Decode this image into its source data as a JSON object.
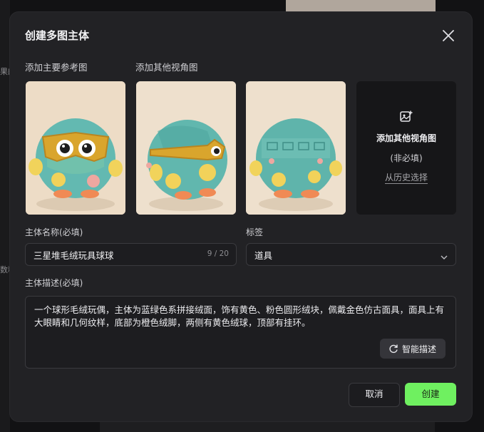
{
  "background": {
    "left_fragments": [
      "果的",
      "数精"
    ]
  },
  "modal": {
    "title": "创建多图主体",
    "main_ref_label": "添加主要参考图",
    "other_views_label": "添加其他视角图",
    "add_view_tile": {
      "title": "添加其他视角图",
      "optional": "(非必填)",
      "history_link": "从历史选择"
    },
    "name_field": {
      "label": "主体名称(必填)",
      "value": "三星堆毛绒玩具球球",
      "counter": "9 / 20"
    },
    "tag_field": {
      "label": "标签",
      "selected": "道具"
    },
    "description_field": {
      "label": "主体描述(必填)",
      "value": "一个球形毛绒玩偶，主体为蓝绿色系拼接绒面，饰有黄色、粉色圆形绒块，佩戴金色仿古面具，面具上有大眼睛和几何纹样，底部为橙色绒脚，两侧有黄色绒球，顶部有挂环。",
      "smart_button": "智能描述"
    },
    "cancel_label": "取消",
    "create_label": "创建"
  },
  "colors": {
    "modal_bg": "#222225",
    "accent_green": "#6ff060",
    "toy_teal": "#5fb8b0"
  }
}
